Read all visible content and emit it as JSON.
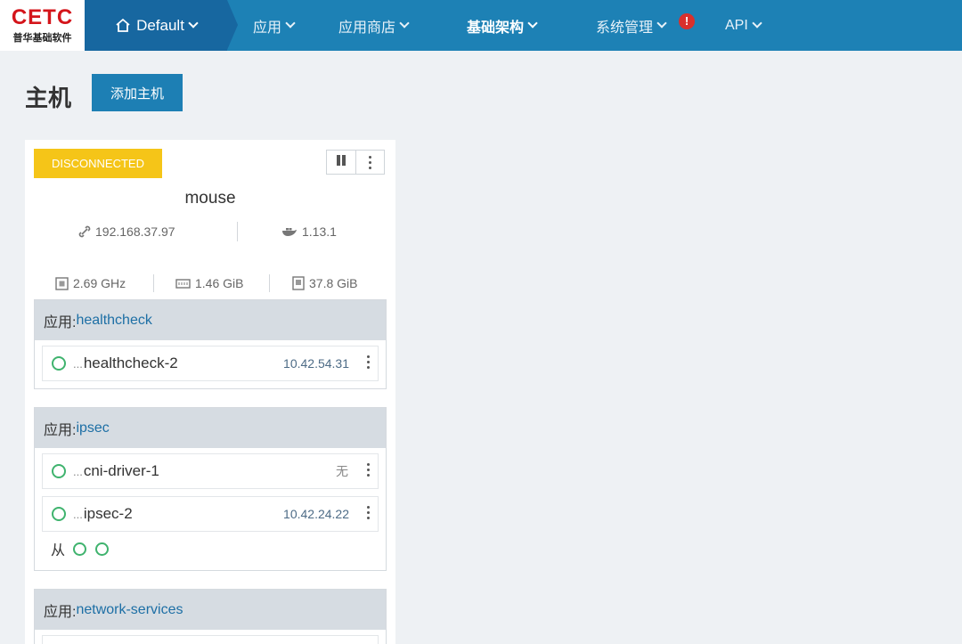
{
  "brand": {
    "logo_text": "CETC",
    "logo_subtitle": "普华基础软件"
  },
  "nav": {
    "environment": "Default",
    "items": [
      {
        "label": "应用"
      },
      {
        "label": "应用商店"
      },
      {
        "label": "基础架构"
      },
      {
        "label": "系统管理"
      },
      {
        "label": "API"
      }
    ],
    "alert_badge": "!"
  },
  "page": {
    "title": "主机",
    "add_button": "添加主机"
  },
  "host": {
    "status": "DISCONNECTED",
    "name": "mouse",
    "ip": "192.168.37.97",
    "docker_version": "1.13.1",
    "cpu": "2.69 GHz",
    "memory": "1.46 GiB",
    "storage": "37.8 GiB",
    "groups": [
      {
        "prefix": "应用: ",
        "name": "healthcheck",
        "containers": [
          {
            "name": "healthcheck-2",
            "ip": "10.42.54.31"
          }
        ]
      },
      {
        "prefix": "应用: ",
        "name": "ipsec",
        "containers": [
          {
            "name": "cni-driver-1",
            "ip": "无"
          },
          {
            "name": "ipsec-2",
            "ip": "10.42.24.22"
          }
        ],
        "sidekick_label": "从"
      },
      {
        "prefix": "应用: ",
        "name": "network-services"
      }
    ],
    "ellipsis": "..."
  },
  "colors": {
    "nav_bg": "#1d81b5",
    "status_warning": "#f5c518",
    "running_ring": "#3fb36e"
  }
}
